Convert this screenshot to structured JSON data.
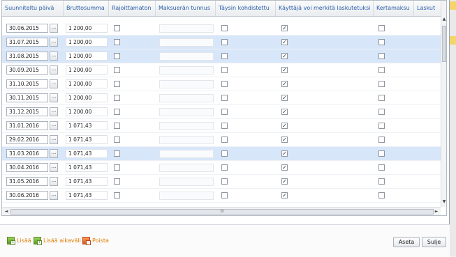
{
  "grid": {
    "headers": [
      "Suunniteltu päivä",
      "Bruttosumma",
      "Rajoittamaton",
      "Maksuerän tunnus",
      "Täysin kohdistettu",
      "Käyttäjä voi merkitä laskutetuksi",
      "Kertamaksu",
      "Laskut"
    ],
    "date_button_label": "...",
    "rows": [
      {
        "date": "30.06.2015",
        "amount": "1 200,00",
        "selected": false,
        "rajoittamaton": false,
        "taysin": false,
        "kayttaja": true,
        "kertamaksu": false
      },
      {
        "date": "31.07.2015",
        "amount": "1 200,00",
        "selected": true,
        "rajoittamaton": false,
        "taysin": false,
        "kayttaja": true,
        "kertamaksu": false
      },
      {
        "date": "31.08.2015",
        "amount": "1 200,00",
        "selected": true,
        "rajoittamaton": false,
        "taysin": false,
        "kayttaja": true,
        "kertamaksu": false
      },
      {
        "date": "30.09.2015",
        "amount": "1 200,00",
        "selected": false,
        "rajoittamaton": false,
        "taysin": false,
        "kayttaja": true,
        "kertamaksu": false
      },
      {
        "date": "31.10.2015",
        "amount": "1 200,00",
        "selected": false,
        "rajoittamaton": false,
        "taysin": false,
        "kayttaja": true,
        "kertamaksu": false
      },
      {
        "date": "30.11.2015",
        "amount": "1 200,00",
        "selected": false,
        "rajoittamaton": false,
        "taysin": false,
        "kayttaja": true,
        "kertamaksu": false
      },
      {
        "date": "31.12.2015",
        "amount": "1 200,00",
        "selected": false,
        "rajoittamaton": false,
        "taysin": false,
        "kayttaja": true,
        "kertamaksu": false
      },
      {
        "date": "31.01.2016",
        "amount": "1 071,43",
        "selected": false,
        "rajoittamaton": false,
        "taysin": false,
        "kayttaja": true,
        "kertamaksu": false
      },
      {
        "date": "29.02.2016",
        "amount": "1 071,43",
        "selected": false,
        "rajoittamaton": false,
        "taysin": false,
        "kayttaja": true,
        "kertamaksu": false
      },
      {
        "date": "31.03.2016",
        "amount": "1 071,43",
        "selected": true,
        "rajoittamaton": false,
        "taysin": false,
        "kayttaja": true,
        "kertamaksu": false
      },
      {
        "date": "30.04.2016",
        "amount": "1 071,43",
        "selected": false,
        "rajoittamaton": false,
        "taysin": false,
        "kayttaja": true,
        "kertamaksu": false
      },
      {
        "date": "31.05.2016",
        "amount": "1 071,43",
        "selected": false,
        "rajoittamaton": false,
        "taysin": false,
        "kayttaja": true,
        "kertamaksu": false
      },
      {
        "date": "30.06.2016",
        "amount": "1 071,43",
        "selected": false,
        "rajoittamaton": false,
        "taysin": false,
        "kayttaja": true,
        "kertamaksu": false
      }
    ]
  },
  "footer": {
    "add_label": "Lisää",
    "add_range_label": "Lisää aikaväli",
    "delete_label": "Poista",
    "aseta_label": "Aseta",
    "sulje_label": "Sulje"
  },
  "scroll_glyphs": {
    "up": "▲",
    "down": "▼",
    "left": "◄",
    "right": "►",
    "grip": "III"
  },
  "colors": {
    "header_text": "#2a5ea8",
    "selected_row": "#d8e6f9",
    "link": "#e07b00"
  },
  "icons": {
    "add": "add-row-icon",
    "add_range": "add-range-icon",
    "delete": "delete-icon",
    "calendar": "ellipsis-button"
  }
}
